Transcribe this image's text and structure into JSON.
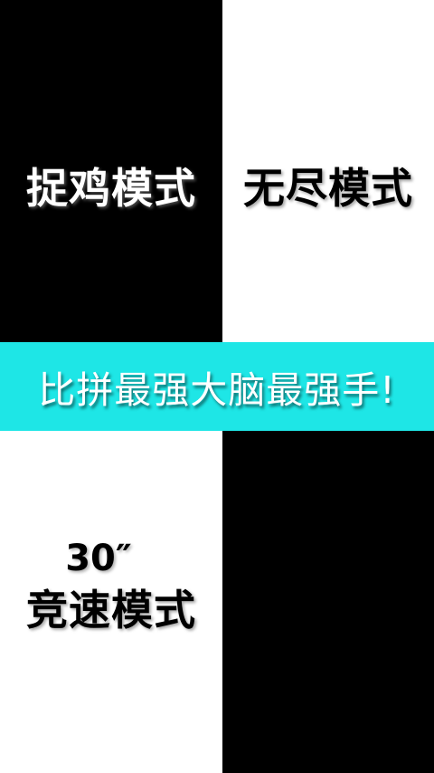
{
  "modes": {
    "catch": {
      "label": "捉鸡模式",
      "color": "black"
    },
    "endless": {
      "label": "无尽模式",
      "color": "white"
    },
    "speed": {
      "time": "30″",
      "label": "竞速模式",
      "color": "white"
    }
  },
  "banner": {
    "text": "比拼最强大脑最强手!",
    "background": "#1ee6e6"
  }
}
